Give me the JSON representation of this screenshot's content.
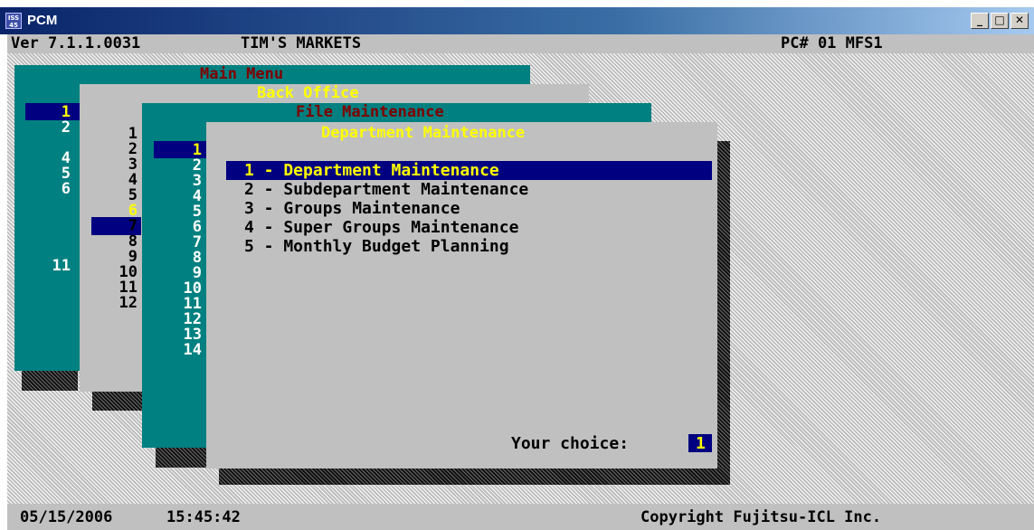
{
  "window": {
    "title": "PCM",
    "icon": "app-icon",
    "buttons": [
      "minimize-icon",
      "maximize-icon",
      "close-icon"
    ]
  },
  "header": {
    "version": "Ver 7.1.1.0031",
    "store": "TIM'S MARKETS",
    "pc": "PC# 01 MFS1"
  },
  "panels": {
    "main_menu": {
      "title": "Main Menu",
      "numbers": [
        "1",
        "2",
        "",
        "4",
        "5",
        "6",
        "",
        "",
        "",
        "",
        "11"
      ],
      "selected": "1"
    },
    "back_office": {
      "title": "Back Office",
      "numbers": [
        "1",
        "2",
        "3",
        "4",
        "5",
        "6",
        "7",
        "8",
        "9",
        "10",
        "11",
        "12"
      ],
      "selected": "6"
    },
    "file_maintenance": {
      "title": "File Maintenance",
      "numbers": [
        "1",
        "2",
        "3",
        "4",
        "5",
        "6",
        "7",
        "8",
        "9",
        "10",
        "11",
        "12",
        "13",
        "14"
      ],
      "selected": "1"
    },
    "department_maintenance": {
      "title": "Department Maintenance",
      "items": [
        "1 - Department Maintenance",
        "2 - Subdepartment Maintenance",
        "3 - Groups Maintenance",
        "4 - Super Groups Maintenance",
        "5 - Monthly Budget Planning"
      ],
      "selected_index": 0,
      "choice_label": "Your choice:",
      "choice_value": "1"
    }
  },
  "status": {
    "date": "05/15/2006",
    "time": "15:45:42",
    "copyright": "Copyright Fujitsu-ICL Inc."
  },
  "colors": {
    "teal": "#008080",
    "grey": "#c0c0c0",
    "navy": "#000080",
    "yellow": "#ffff00",
    "red": "#800000"
  }
}
